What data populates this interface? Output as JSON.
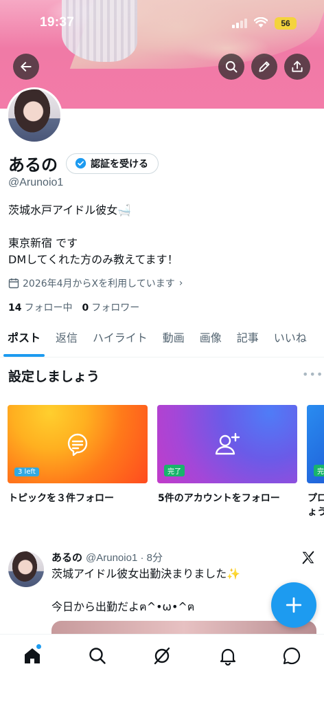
{
  "status_bar": {
    "time": "19:37",
    "battery": "56"
  },
  "profile": {
    "display_name": "あるの",
    "verify_label": "認証を受ける",
    "handle": "@Arunoio1",
    "bio_lines": [
      "茨城水戸アイドル彼女🛁",
      "",
      "東京新宿 です",
      "DMしてくれた方のみ教えてます！"
    ],
    "joined": "2026年4月からXを利用しています",
    "following_count": "14",
    "following_label": "フォロー中",
    "followers_count": "0",
    "followers_label": "フォロワー"
  },
  "tabs": [
    "ポスト",
    "返信",
    "ハイライト",
    "動画",
    "画像",
    "記事",
    "いいね"
  ],
  "setup": {
    "title": "設定しましょう",
    "cards": [
      {
        "tag": "3 left",
        "caption": "トピックを３件フォロー",
        "icon": "topic-icon"
      },
      {
        "tag": "完了",
        "caption": "5件のアカウントをフォロー",
        "icon": "add-user-icon"
      },
      {
        "tag": "完",
        "caption": "プロ",
        "caption2": "ょう",
        "icon": "profile-icon"
      }
    ]
  },
  "post": {
    "name": "あるの",
    "meta": "@Arunoio1 · 8分",
    "lines": [
      "茨城アイドル彼女出勤決まりました✨",
      "",
      "今日から出勤だよฅ^•ω•^ฅ"
    ]
  },
  "colors": {
    "accent": "#1d9bf0",
    "text": "#0f1419",
    "muted": "#536471"
  }
}
